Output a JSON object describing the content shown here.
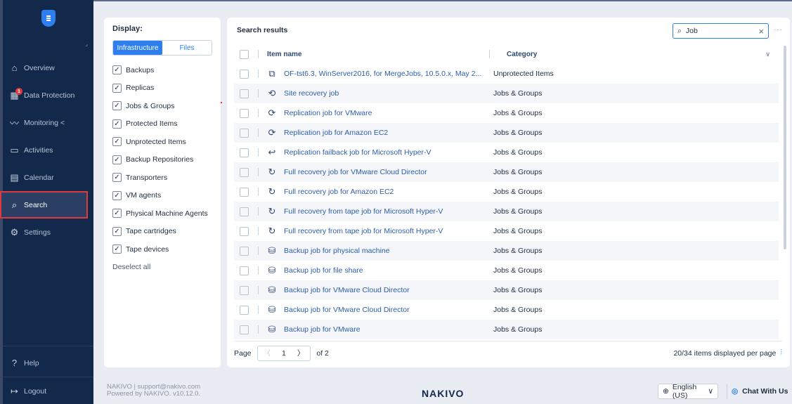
{
  "sidebar": {
    "items": [
      {
        "label": "Overview",
        "icon": "home-icon",
        "glyph": "⌂"
      },
      {
        "label": "Data Protection",
        "icon": "grid-icon",
        "glyph": "▦",
        "badge": "1"
      },
      {
        "label": "Monitoring  <",
        "icon": "chart-line-icon",
        "glyph": "〰"
      },
      {
        "label": "Activities",
        "icon": "activities-icon",
        "glyph": "▭"
      },
      {
        "label": "Calendar",
        "icon": "calendar-icon",
        "glyph": "▤"
      },
      {
        "label": "Search",
        "icon": "search-icon",
        "glyph": "⌕"
      },
      {
        "label": "Settings",
        "icon": "gear-icon",
        "glyph": "⚙"
      }
    ],
    "help": {
      "label": "Help",
      "glyph": "?"
    },
    "logout": {
      "label": "Logout",
      "glyph": "↦"
    }
  },
  "filter": {
    "title": "Display:",
    "tabs": [
      "Infrastructure",
      "Files"
    ],
    "options": [
      "Backups",
      "Replicas",
      "Jobs & Groups",
      "Protected Items",
      "Unprotected Items",
      "Backup Repositories",
      "Transporters",
      "VM agents",
      "Physical Machine Agents",
      "Tape cartridges",
      "Tape devices"
    ],
    "deselect_all": "Deselect all"
  },
  "results": {
    "title": "Search results",
    "search_value": "Job",
    "columns": {
      "name": "Item name",
      "category": "Category"
    },
    "rows": [
      {
        "name": "OF-tst6.3, WinServer2016, for MergeJobs, 10.5.0.x, May 2...",
        "category": "Unprotected Items",
        "glyph": "⧉"
      },
      {
        "name": "Site recovery job",
        "category": "Jobs & Groups",
        "glyph": "⟲"
      },
      {
        "name": "Replication job for VMware",
        "category": "Jobs & Groups",
        "glyph": "⟳"
      },
      {
        "name": "Replication job for Amazon EC2",
        "category": "Jobs & Groups",
        "glyph": "⟳"
      },
      {
        "name": "Replication failback job for Microsoft Hyper-V",
        "category": "Jobs & Groups",
        "glyph": "↩"
      },
      {
        "name": "Full recovery job for VMware Cloud Director",
        "category": "Jobs & Groups",
        "glyph": "↻"
      },
      {
        "name": "Full recovery job for Amazon EC2",
        "category": "Jobs & Groups",
        "glyph": "↻"
      },
      {
        "name": "Full recovery from tape job for Microsoft Hyper-V",
        "category": "Jobs & Groups",
        "glyph": "↻"
      },
      {
        "name": "Full recovery from tape job for Microsoft Hyper-V",
        "category": "Jobs & Groups",
        "glyph": "↻"
      },
      {
        "name": "Backup job for physical machine",
        "category": "Jobs & Groups",
        "glyph": "⛁"
      },
      {
        "name": "Backup job for file share",
        "category": "Jobs & Groups",
        "glyph": "⛁"
      },
      {
        "name": "Backup job for VMware Cloud Director",
        "category": "Jobs & Groups",
        "glyph": "⛁"
      },
      {
        "name": "Backup job for VMware Cloud Director",
        "category": "Jobs & Groups",
        "glyph": "⛁"
      },
      {
        "name": "Backup job for VMware",
        "category": "Jobs & Groups",
        "glyph": "⛁"
      }
    ],
    "pager": {
      "page_label": "Page",
      "page": "1",
      "of": "of 2",
      "summary": "20/34 items displayed per page"
    }
  },
  "footer": {
    "support_line1": "NAKIVO | support@nakivo.com",
    "support_line2": "Powered by NAKIVO. v10.12.0.",
    "brand": "NAKIVO",
    "language": "English (US)",
    "chat": "Chat With Us"
  },
  "colors": {
    "sidebar": "#13294b",
    "accent": "#2d7ff0",
    "active_border": "#e0393e"
  }
}
